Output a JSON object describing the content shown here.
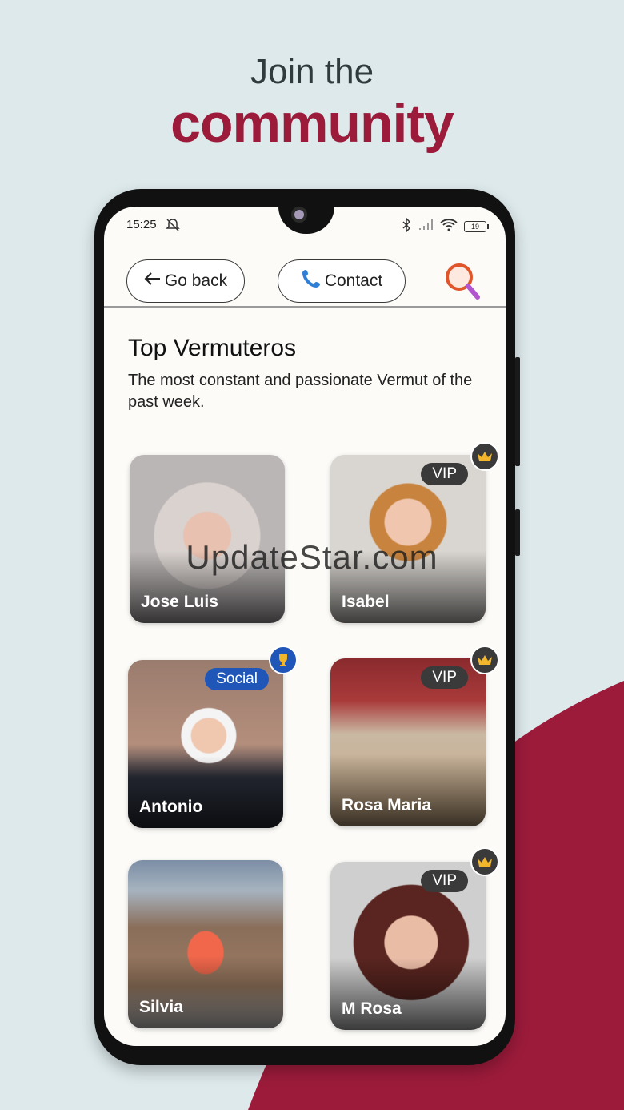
{
  "promo": {
    "headline_line1": "Join the",
    "headline_line2": "community",
    "brand_color": "#9c1b3b"
  },
  "status_bar": {
    "time": "15:25",
    "battery": "19"
  },
  "toolbar": {
    "back_label": "Go back",
    "contact_label": "Contact"
  },
  "section": {
    "title": "Top Vermuteros",
    "subtitle": "The most constant and passionate Vermut of the past week."
  },
  "profiles": [
    {
      "name": "Jose Luis",
      "tag": "",
      "badge": ""
    },
    {
      "name": "Isabel",
      "tag": "VIP",
      "badge": "crown-icon"
    },
    {
      "name": "Antonio",
      "tag": "Social",
      "badge": "trophy-icon"
    },
    {
      "name": "Rosa Maria",
      "tag": "VIP",
      "badge": "crown-icon"
    },
    {
      "name": "Silvia",
      "tag": "",
      "badge": ""
    },
    {
      "name": "M Rosa",
      "tag": "VIP",
      "badge": "crown-icon"
    }
  ],
  "watermark": "UpdateStar.com"
}
